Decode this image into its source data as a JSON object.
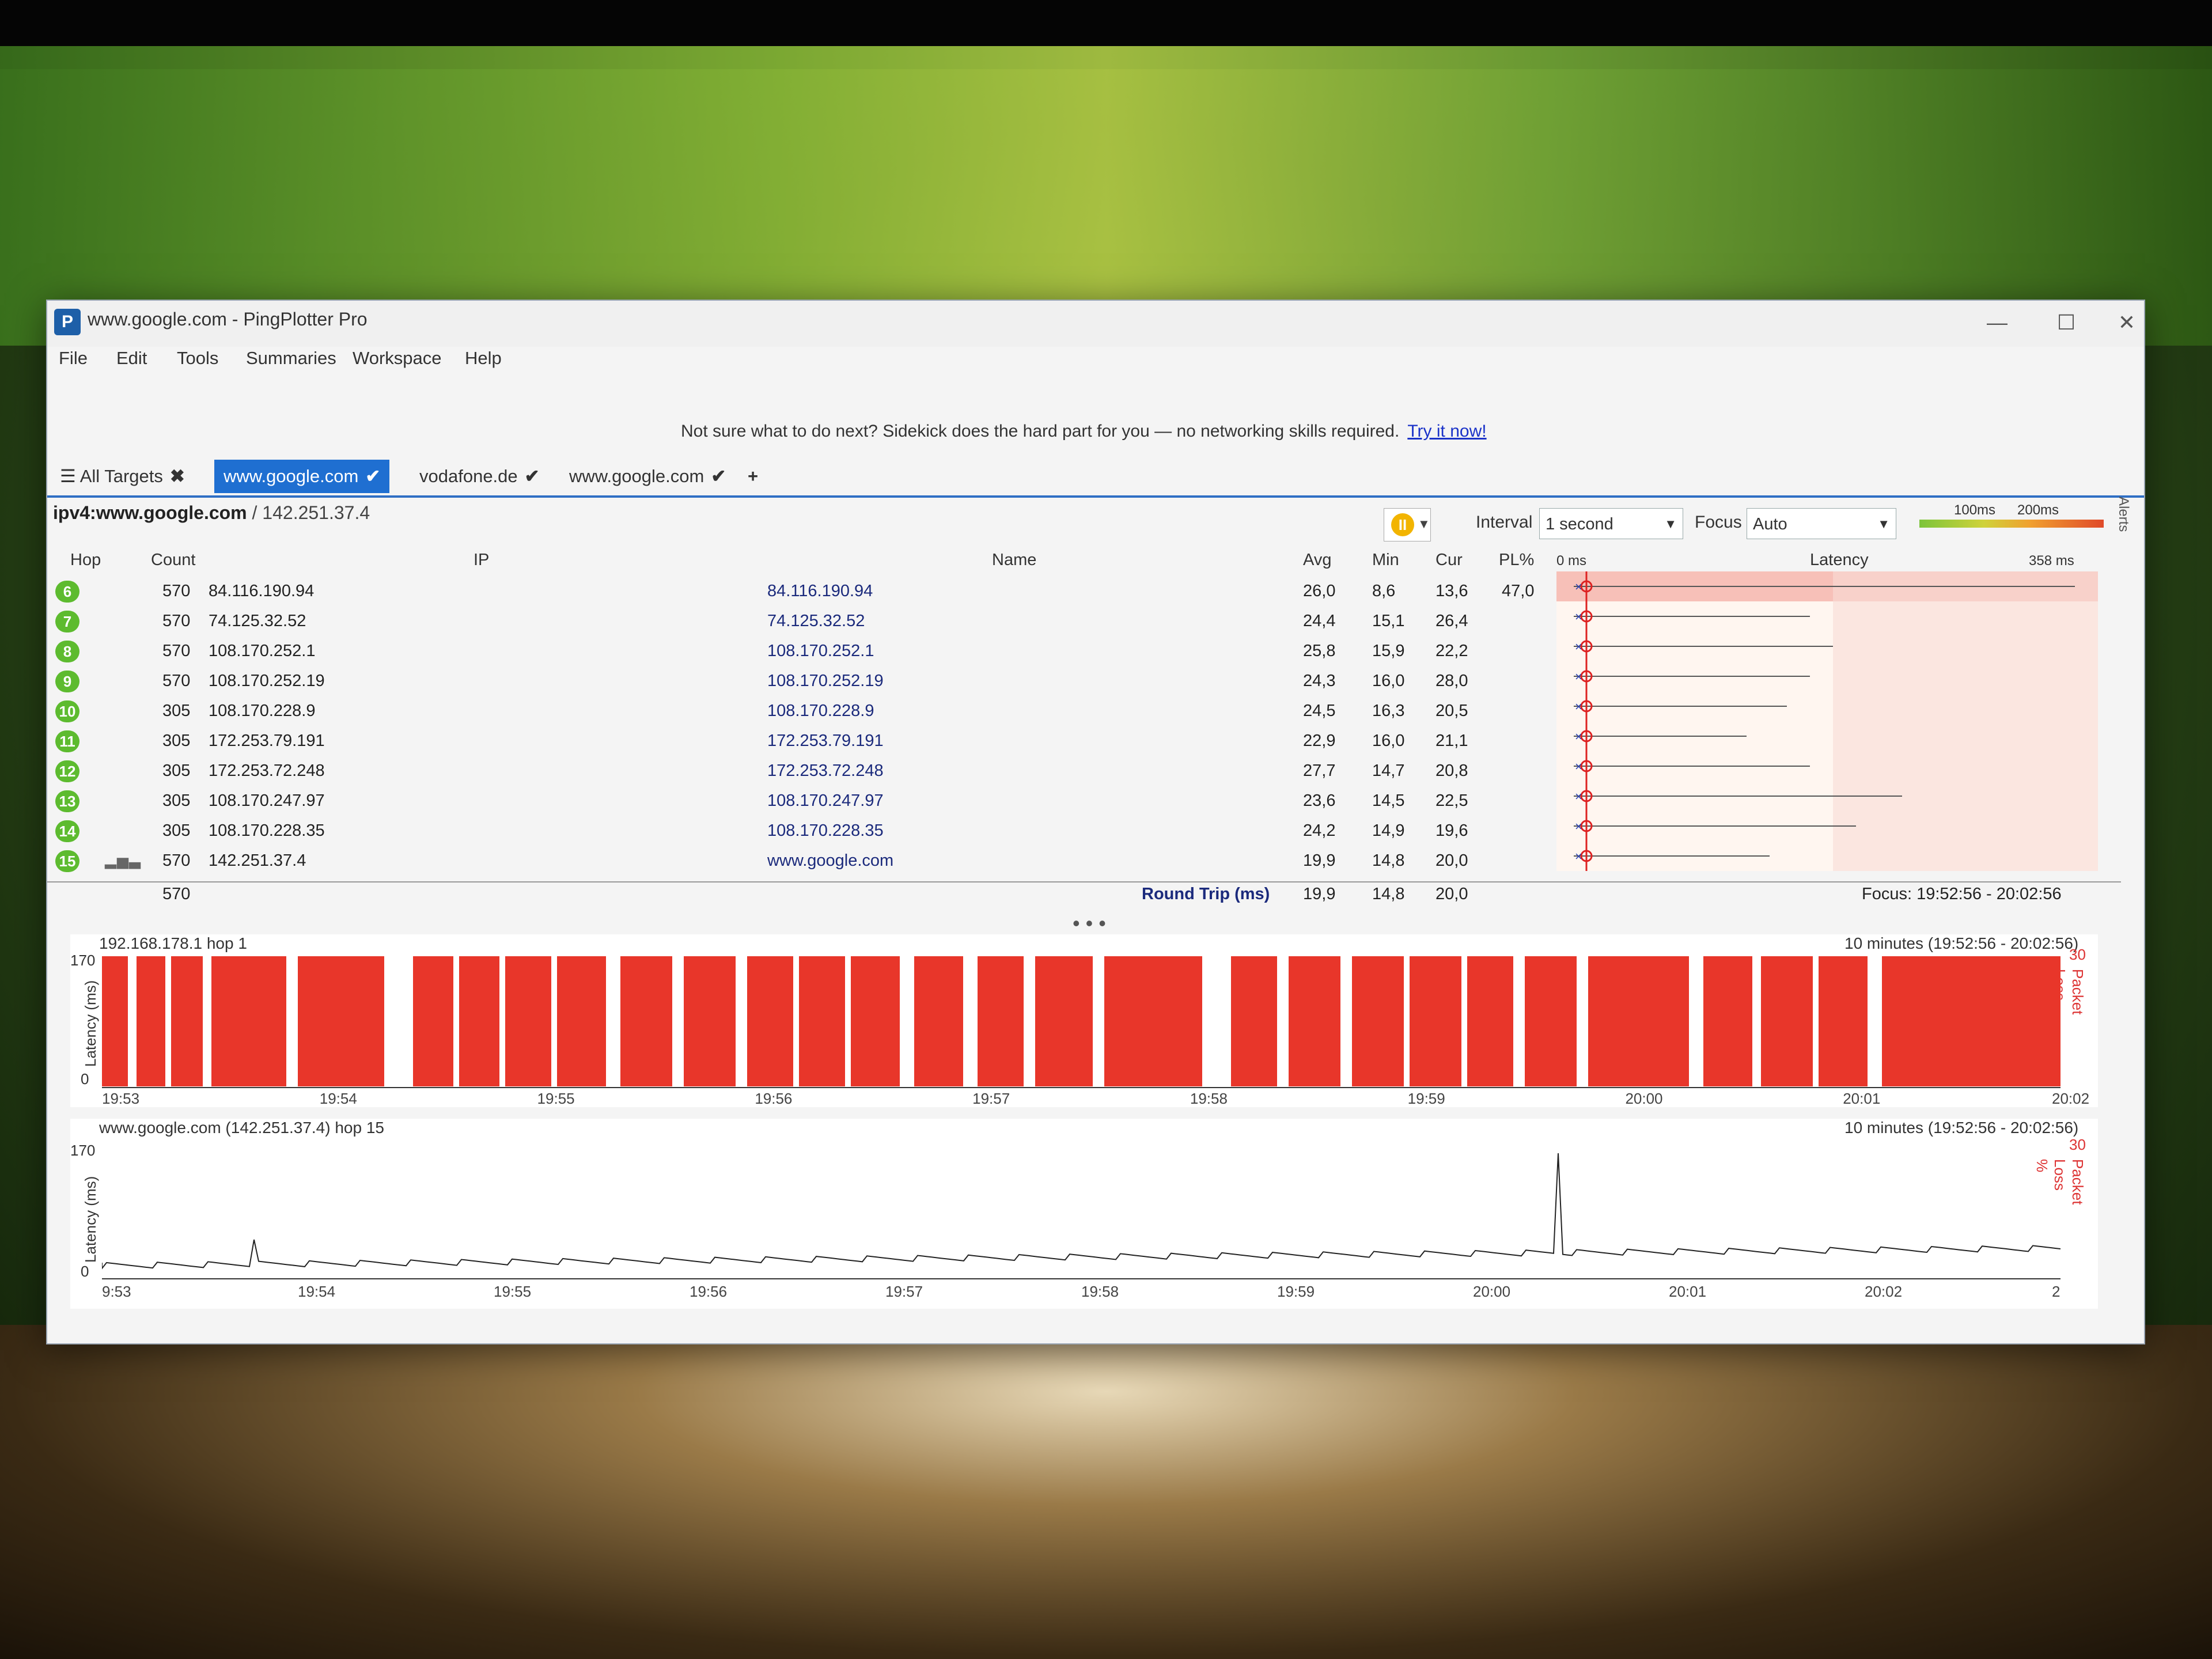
{
  "window": {
    "title": "www.google.com - PingPlotter Pro",
    "app_icon_glyph": "P",
    "controls": [
      "—",
      "☐",
      "✕"
    ]
  },
  "menu": [
    "File",
    "Edit",
    "Tools",
    "Summaries",
    "Workspace",
    "Help"
  ],
  "sidekick": {
    "text": "Not sure what to do next? Sidekick does the hard part for you — no networking skills required.",
    "link": "Try it now!"
  },
  "tabs": [
    {
      "label": "All Targets",
      "mark": "✖",
      "active": false
    },
    {
      "label": "www.google.com",
      "mark": "✔",
      "active": true
    },
    {
      "label": "vodafone.de",
      "mark": "✔",
      "active": false
    },
    {
      "label": "www.google.com",
      "mark": "✔",
      "active": false
    }
  ],
  "add_tab": "+",
  "target": {
    "host": "ipv4:www.google.com",
    "ip": "/ 142.251.37.4"
  },
  "toolbar": {
    "interval_label": "Interval",
    "interval_value": "1 second",
    "focus_label": "Focus",
    "focus_value": "Auto",
    "scale_100": "100ms",
    "scale_200": "200ms",
    "alerts": "Alerts"
  },
  "columns": {
    "hop": "Hop",
    "count": "Count",
    "ip": "IP",
    "name": "Name",
    "avg": "Avg",
    "min": "Min",
    "cur": "Cur",
    "pl": "PL%",
    "zero_ms": "0 ms",
    "latency": "Latency",
    "max_ms": "358 ms"
  },
  "hops": [
    {
      "hop": "6",
      "count": "570",
      "ip": "84.116.190.94",
      "name": "84.116.190.94",
      "avg": "26,0",
      "min": "8,6",
      "cur": "13,6",
      "pl": "47,0"
    },
    {
      "hop": "7",
      "count": "570",
      "ip": "74.125.32.52",
      "name": "74.125.32.52",
      "avg": "24,4",
      "min": "15,1",
      "cur": "26,4",
      "pl": ""
    },
    {
      "hop": "8",
      "count": "570",
      "ip": "108.170.252.1",
      "name": "108.170.252.1",
      "avg": "25,8",
      "min": "15,9",
      "cur": "22,2",
      "pl": ""
    },
    {
      "hop": "9",
      "count": "570",
      "ip": "108.170.252.19",
      "name": "108.170.252.19",
      "avg": "24,3",
      "min": "16,0",
      "cur": "28,0",
      "pl": ""
    },
    {
      "hop": "10",
      "count": "305",
      "ip": "108.170.228.9",
      "name": "108.170.228.9",
      "avg": "24,5",
      "min": "16,3",
      "cur": "20,5",
      "pl": ""
    },
    {
      "hop": "11",
      "count": "305",
      "ip": "172.253.79.191",
      "name": "172.253.79.191",
      "avg": "22,9",
      "min": "16,0",
      "cur": "21,1",
      "pl": ""
    },
    {
      "hop": "12",
      "count": "305",
      "ip": "172.253.72.248",
      "name": "172.253.72.248",
      "avg": "27,7",
      "min": "14,7",
      "cur": "20,8",
      "pl": ""
    },
    {
      "hop": "13",
      "count": "305",
      "ip": "108.170.247.97",
      "name": "108.170.247.97",
      "avg": "23,6",
      "min": "14,5",
      "cur": "22,5",
      "pl": ""
    },
    {
      "hop": "14",
      "count": "305",
      "ip": "108.170.228.35",
      "name": "108.170.228.35",
      "avg": "24,2",
      "min": "14,9",
      "cur": "19,6",
      "pl": ""
    },
    {
      "hop": "15",
      "count": "570",
      "ip": "142.251.37.4",
      "name": "www.google.com",
      "avg": "19,9",
      "min": "14,8",
      "cur": "20,0",
      "pl": ""
    }
  ],
  "round_trip": {
    "count": "570",
    "label": "Round Trip (ms)",
    "avg": "19,9",
    "min": "14,8",
    "cur": "20,0",
    "focus": "Focus: 19:52:56 - 20:02:56"
  },
  "divider": "• • •",
  "graph1": {
    "title": "192.168.178.1 hop 1",
    "range": "10 minutes (19:52:56 - 20:02:56)",
    "y_max": "170",
    "y_min": "0",
    "ylabel": "Latency (ms)",
    "pl_max": "30",
    "pl_label": "Packet Loss %",
    "x_ticks": [
      "19:53",
      "19:54",
      "19:55",
      "19:56",
      "19:57",
      "19:58",
      "19:59",
      "20:00",
      "20:01",
      "20:02"
    ]
  },
  "graph2": {
    "title": "www.google.com (142.251.37.4) hop 15",
    "range": "10 minutes (19:52:56 - 20:02:56)",
    "y_max": "170",
    "y_min": "0",
    "ylabel": "Latency (ms)",
    "pl_max": "30",
    "pl_label": "Packet Loss %",
    "x_ticks": [
      "9:53",
      "19:54",
      "19:55",
      "19:56",
      "19:57",
      "19:58",
      "19:59",
      "20:00",
      "20:01",
      "20:02",
      "2"
    ]
  },
  "colors": {
    "accent": "#1f6fd1",
    "hop_green": "#5dbb2f",
    "loss_red": "#e8362a",
    "link": "#1a32c8"
  }
}
